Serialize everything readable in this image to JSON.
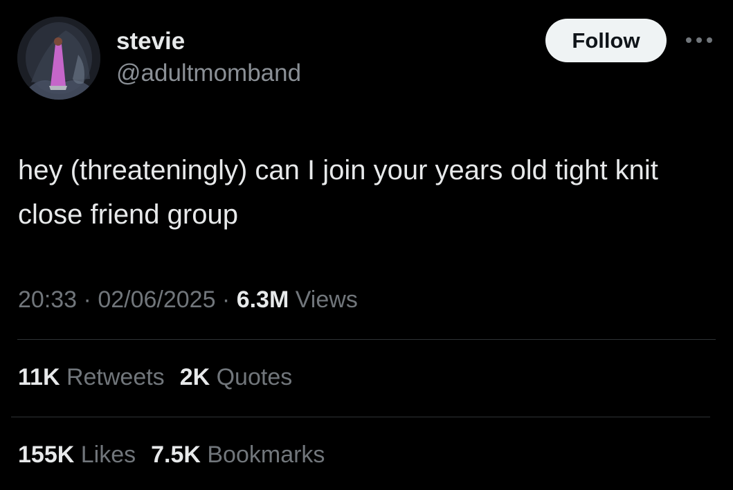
{
  "user": {
    "display_name": "stevie",
    "handle": "@adultmomband"
  },
  "actions": {
    "follow_label": "Follow",
    "more_icon": "more-horizontal-icon"
  },
  "tweet": {
    "text": "hey (threateningly) can I join your years old tight knit close friend group",
    "time": "20:33",
    "separator": " · ",
    "date": "02/06/2025",
    "views_count": "6.3M",
    "views_label": " Views"
  },
  "stats": {
    "retweets_count": "11K",
    "retweets_label": " Retweets",
    "quotes_count": "2K",
    "quotes_label": " Quotes",
    "likes_count": "155K",
    "likes_label": " Likes",
    "bookmarks_count": "7.5K",
    "bookmarks_label": " Bookmarks"
  },
  "colors": {
    "background": "#000000",
    "primary_text": "#e7e9ea",
    "secondary_text": "#71767b",
    "divider": "#2f3336",
    "follow_bg": "#eff3f4"
  }
}
